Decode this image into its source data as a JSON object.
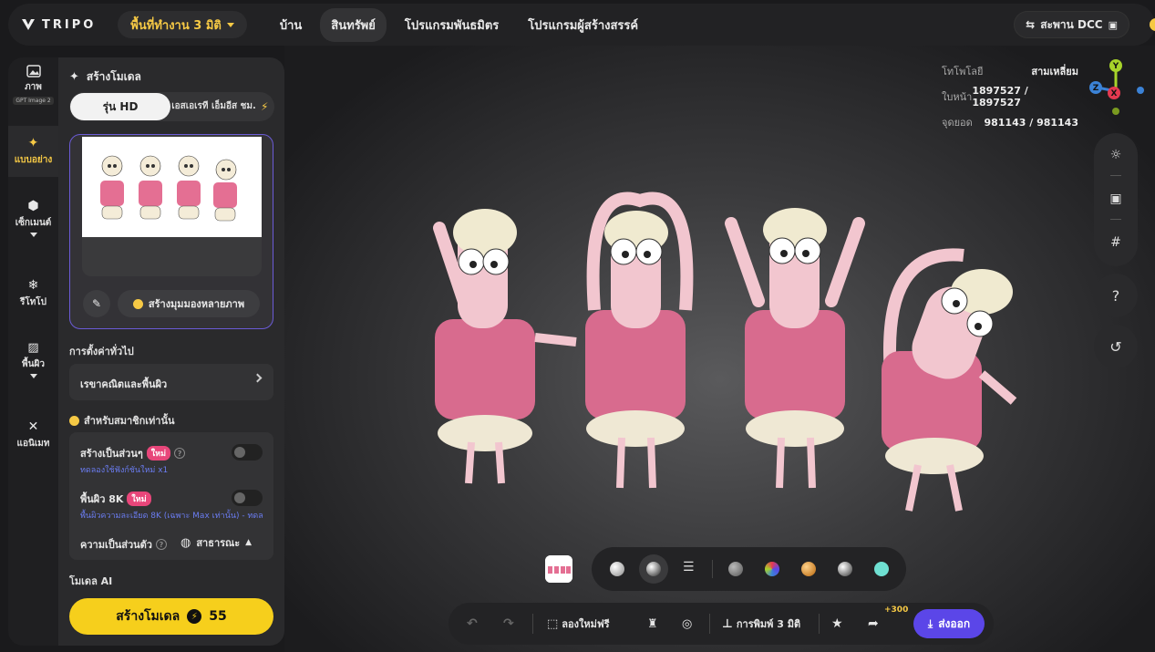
{
  "header": {
    "logo_text": "TRIPO",
    "workspace_label": "พื้นที่ทำงาน 3 มิติ",
    "nav": [
      {
        "label": "บ้าน",
        "active": false
      },
      {
        "label": "สินทรัพย์",
        "active": true
      },
      {
        "label": "โปรแกรมพันธมิตร",
        "active": false
      },
      {
        "label": "โปรแกรมผู้สร้างสรรค์",
        "active": false
      }
    ],
    "dcc_label": "สะพาน DCC"
  },
  "rail": {
    "items": [
      {
        "label": "ภาพ",
        "badge": "GPT Image 2",
        "icon": "image-icon"
      },
      {
        "label": "แบบอย่าง",
        "icon": "sparkle-icon",
        "active": true
      },
      {
        "label": "เซ็กเมนต์",
        "icon": "cube-icon"
      },
      {
        "label": "รีโทโป",
        "icon": "retopo-icon"
      },
      {
        "label": "พื้นผิว",
        "icon": "texture-icon"
      },
      {
        "label": "แอนิเมท",
        "icon": "figure-icon"
      }
    ]
  },
  "panel": {
    "title": "สร้างโมเดล",
    "seg_hd": "รุ่น HD",
    "seg_other": "เอสเอเรที เอ็มอีส ชม.",
    "multi_view_label": "สร้างมุมมองหลายภาพ",
    "general_settings": "การตั้งค่าทั่วไป",
    "geometry_texture": "เรขาคณิตและพื้นผิว",
    "members_only": "สำหรับสมาชิกเท่านั้น",
    "parts_label": "สร้างเป็นส่วนๆ",
    "new_badge": "ใหม่",
    "parts_note": "ทดลองใช้ฟังก์ชันใหม่ x1",
    "texture8k_label": "พื้นผิว 8K",
    "texture8k_note": "พื้นผิวความละเอียด 8K (เฉพาะ Max เท่านั้น) - ทดล",
    "privacy_label": "ความเป็นส่วนตัว",
    "privacy_value": "สาธารณะ",
    "ai_model": "โมเดล AI",
    "generate_label": "สร้างโมเดล",
    "generate_cost": "55"
  },
  "viewport": {
    "stats": [
      {
        "key": "โทโพโลยี",
        "value": "สามเหลี่ยม"
      },
      {
        "key": "ใบหน้า",
        "value": "1897527 / 1897527"
      },
      {
        "key": "จุดยอด",
        "value": "981143 / 981143"
      }
    ],
    "axes": {
      "y": "Y",
      "z": "Z",
      "x": "X"
    },
    "help_glyph": "?",
    "bottom": {
      "try_free": "ลองใหม่ฟรี",
      "print3d": "การพิมพ์ 3 มิติ",
      "plus": "+300",
      "export": "ส่งออก"
    }
  },
  "colors": {
    "accent_yellow": "#f6cf1c",
    "purple": "#5b46e8",
    "pink": "#d86b8e"
  }
}
